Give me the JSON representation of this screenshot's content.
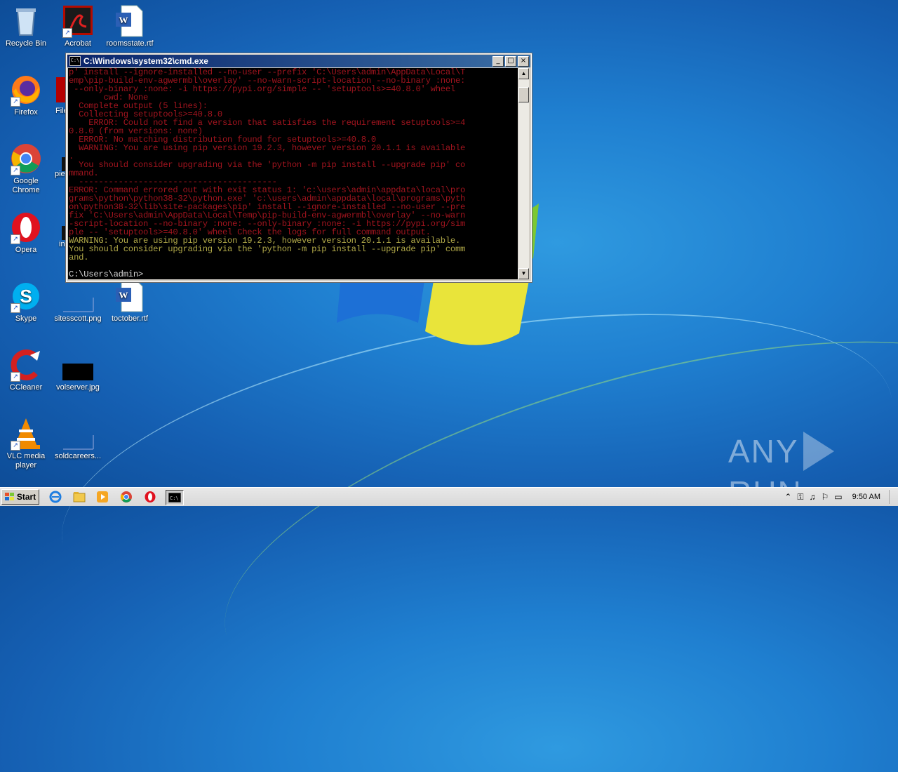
{
  "desktop": {
    "icons": [
      {
        "label": "Recycle Bin",
        "icon": "recycle-bin-icon"
      },
      {
        "label": "Acrobat Reader DC",
        "icon": "acrobat-icon"
      },
      {
        "label": "roomsstate.rtf",
        "icon": "word-document-icon"
      },
      {
        "label": "Firefox",
        "icon": "firefox-icon"
      },
      {
        "label": "FileZilla Client",
        "icon": "filezilla-icon"
      },
      {
        "label": "Google Chrome",
        "icon": "chrome-icon"
      },
      {
        "label": "pie",
        "icon": "file-icon"
      },
      {
        "label": "Opera",
        "icon": "opera-icon"
      },
      {
        "label": "in",
        "icon": "file-icon"
      },
      {
        "label": "Skype",
        "icon": "skype-icon"
      },
      {
        "label": "sitesscott.png",
        "icon": "image-file-icon"
      },
      {
        "label": "toctober.rtf",
        "icon": "word-document-icon"
      },
      {
        "label": "CCleaner",
        "icon": "ccleaner-icon"
      },
      {
        "label": "volserver.jpg",
        "icon": "image-file-icon"
      },
      {
        "label": "VLC media player",
        "icon": "vlc-icon"
      },
      {
        "label": "soldcareers...",
        "icon": "image-file-icon"
      }
    ],
    "watermark": {
      "left": "ANY",
      "right": "RUN"
    }
  },
  "cmd": {
    "title": "C:\\Windows\\system32\\cmd.exe",
    "lines": [
      {
        "color": "red",
        "text": "p' install --ignore-installed --no-user --prefix 'C:\\Users\\admin\\AppData\\Local\\T"
      },
      {
        "color": "red",
        "text": "emp\\pip-build-env-agwermbl\\overlay' --no-warn-script-location --no-binary :none:"
      },
      {
        "color": "red",
        "text": " --only-binary :none: -i https://pypi.org/simple -- 'setuptools>=40.8.0' wheel"
      },
      {
        "color": "red",
        "text": "       cwd: None"
      },
      {
        "color": "red",
        "text": "  Complete output (5 lines):"
      },
      {
        "color": "red",
        "text": "  Collecting setuptools>=40.8.0"
      },
      {
        "color": "red",
        "text": "    ERROR: Could not find a version that satisfies the requirement setuptools>=4"
      },
      {
        "color": "red",
        "text": "0.8.0 (from versions: none)"
      },
      {
        "color": "red",
        "text": "  ERROR: No matching distribution found for setuptools>=40.8.0"
      },
      {
        "color": "red",
        "text": "  WARNING: You are using pip version 19.2.3, however version 20.1.1 is available"
      },
      {
        "color": "red",
        "text": "."
      },
      {
        "color": "red",
        "text": "  You should consider upgrading via the 'python -m pip install --upgrade pip' co"
      },
      {
        "color": "red",
        "text": "mmand."
      },
      {
        "color": "red",
        "text": "  ----------------------------------------"
      },
      {
        "color": "red",
        "text": "ERROR: Command errored out with exit status 1: 'c:\\users\\admin\\appdata\\local\\pro"
      },
      {
        "color": "red",
        "text": "grams\\python\\python38-32\\python.exe' 'c:\\users\\admin\\appdata\\local\\programs\\pyth"
      },
      {
        "color": "red",
        "text": "on\\python38-32\\lib\\site-packages\\pip' install --ignore-installed --no-user --pre"
      },
      {
        "color": "red",
        "text": "fix 'C:\\Users\\admin\\AppData\\Local\\Temp\\pip-build-env-agwermbl\\overlay' --no-warn"
      },
      {
        "color": "red",
        "text": "-script-location --no-binary :none: --only-binary :none: -i https://pypi.org/sim"
      },
      {
        "color": "red",
        "text": "ple -- 'setuptools>=40.8.0' wheel Check the logs for full command output."
      },
      {
        "color": "yellow",
        "text": "WARNING: You are using pip version 19.2.3, however version 20.1.1 is available."
      },
      {
        "color": "yellow",
        "text": "You should consider upgrading via the 'python -m pip install --upgrade pip' comm"
      },
      {
        "color": "yellow",
        "text": "and."
      },
      {
        "color": "white",
        "text": ""
      },
      {
        "color": "white",
        "text": "C:\\Users\\admin>"
      }
    ],
    "buttons": {
      "minimize": "_",
      "maximize": "□",
      "close": "×"
    }
  },
  "taskbar": {
    "start_label": "Start",
    "items": [
      "ie-icon",
      "explorer-icon",
      "media-player-icon",
      "chrome-icon",
      "opera-icon",
      "cmd-icon"
    ],
    "clock": "9:50 AM"
  }
}
